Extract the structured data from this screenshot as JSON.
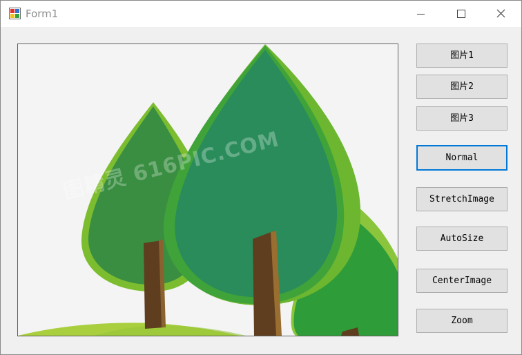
{
  "window": {
    "title": "Form1",
    "icon": "winforms-app-icon"
  },
  "title_bar": {
    "minimize_icon": "minimize-icon",
    "maximize_icon": "maximize-icon",
    "close_icon": "close-icon"
  },
  "picture": {
    "watermark": "图精灵 616PIC.COM",
    "description_icon": "trees-illustration"
  },
  "buttons": {
    "image1": "图片1",
    "image2": "图片2",
    "image3": "图片3",
    "normal": "Normal",
    "stretch": "StretchImage",
    "autosize": "AutoSize",
    "center": "CenterImage",
    "zoom": "Zoom"
  },
  "colors": {
    "focus_border": "#0078d7",
    "button_bg": "#e1e1e1",
    "window_bg": "#f0f0f0"
  }
}
